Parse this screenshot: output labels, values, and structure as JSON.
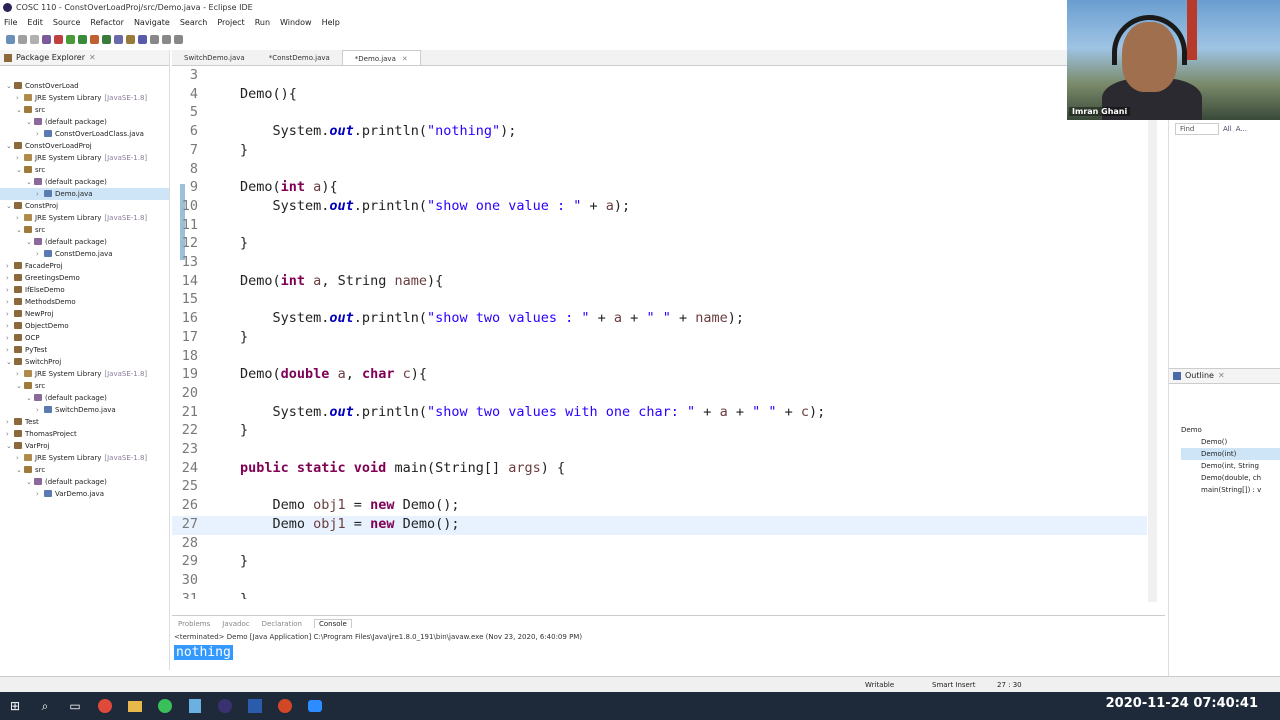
{
  "window": {
    "title": "COSC 110 - ConstOverLoadProj/src/Demo.java - Eclipse IDE"
  },
  "menu": [
    "File",
    "Edit",
    "Source",
    "Refactor",
    "Navigate",
    "Search",
    "Project",
    "Run",
    "Window",
    "Help"
  ],
  "package_explorer": {
    "title": "Package Explorer",
    "tree": [
      {
        "label": "ConstOverLoad",
        "level": 0,
        "arrow": "⌄",
        "kind": "project"
      },
      {
        "label": "JRE System Library",
        "suffix": "[JavaSE-1.8]",
        "level": 1,
        "arrow": "›",
        "kind": "lib"
      },
      {
        "label": "src",
        "level": 1,
        "arrow": "⌄",
        "kind": "src"
      },
      {
        "label": "(default package)",
        "level": 2,
        "arrow": "⌄",
        "kind": "pkg"
      },
      {
        "label": "ConstOverLoadClass.java",
        "level": 3,
        "arrow": "›",
        "kind": "file"
      },
      {
        "label": "ConstOverLoadProj",
        "level": 0,
        "arrow": "⌄",
        "kind": "project"
      },
      {
        "label": "JRE System Library",
        "suffix": "[JavaSE-1.8]",
        "level": 1,
        "arrow": "›",
        "kind": "lib"
      },
      {
        "label": "src",
        "level": 1,
        "arrow": "⌄",
        "kind": "src"
      },
      {
        "label": "(default package)",
        "level": 2,
        "arrow": "⌄",
        "kind": "pkg"
      },
      {
        "label": "Demo.java",
        "level": 3,
        "arrow": "›",
        "kind": "file",
        "selected": true
      },
      {
        "label": "ConstProj",
        "level": 0,
        "arrow": "⌄",
        "kind": "project"
      },
      {
        "label": "JRE System Library",
        "suffix": "[JavaSE-1.8]",
        "level": 1,
        "arrow": "›",
        "kind": "lib"
      },
      {
        "label": "src",
        "level": 1,
        "arrow": "⌄",
        "kind": "src"
      },
      {
        "label": "(default package)",
        "level": 2,
        "arrow": "⌄",
        "kind": "pkg"
      },
      {
        "label": "ConstDemo.java",
        "level": 3,
        "arrow": "›",
        "kind": "file"
      },
      {
        "label": "FacadeProj",
        "level": 0,
        "arrow": "›",
        "kind": "project"
      },
      {
        "label": "GreetingsDemo",
        "level": 0,
        "arrow": "›",
        "kind": "project"
      },
      {
        "label": "IfElseDemo",
        "level": 0,
        "arrow": "›",
        "kind": "project"
      },
      {
        "label": "MethodsDemo",
        "level": 0,
        "arrow": "›",
        "kind": "project"
      },
      {
        "label": "NewProj",
        "level": 0,
        "arrow": "›",
        "kind": "project"
      },
      {
        "label": "ObjectDemo",
        "level": 0,
        "arrow": "›",
        "kind": "project"
      },
      {
        "label": "OCP",
        "level": 0,
        "arrow": "›",
        "kind": "project"
      },
      {
        "label": "PyTest",
        "level": 0,
        "arrow": "›",
        "kind": "project"
      },
      {
        "label": "SwitchProj",
        "level": 0,
        "arrow": "⌄",
        "kind": "project"
      },
      {
        "label": "JRE System Library",
        "suffix": "[JavaSE-1.8]",
        "level": 1,
        "arrow": "›",
        "kind": "lib"
      },
      {
        "label": "src",
        "level": 1,
        "arrow": "⌄",
        "kind": "src"
      },
      {
        "label": "(default package)",
        "level": 2,
        "arrow": "⌄",
        "kind": "pkg"
      },
      {
        "label": "SwitchDemo.java",
        "level": 3,
        "arrow": "›",
        "kind": "file"
      },
      {
        "label": "Test",
        "level": 0,
        "arrow": "›",
        "kind": "project"
      },
      {
        "label": "ThomasProject",
        "level": 0,
        "arrow": "›",
        "kind": "project"
      },
      {
        "label": "VarProj",
        "level": 0,
        "arrow": "⌄",
        "kind": "project"
      },
      {
        "label": "JRE System Library",
        "suffix": "[JavaSE-1.8]",
        "level": 1,
        "arrow": "›",
        "kind": "lib"
      },
      {
        "label": "src",
        "level": 1,
        "arrow": "⌄",
        "kind": "src"
      },
      {
        "label": "(default package)",
        "level": 2,
        "arrow": "⌄",
        "kind": "pkg"
      },
      {
        "label": "VarDemo.java",
        "level": 3,
        "arrow": "›",
        "kind": "file"
      }
    ]
  },
  "editor_tabs": [
    {
      "label": "SwitchDemo.java",
      "active": false
    },
    {
      "label": "*ConstDemo.java",
      "active": false
    },
    {
      "label": "*Demo.java",
      "active": true
    }
  ],
  "code_lines": [
    {
      "n": "3",
      "tokens": []
    },
    {
      "n": "4",
      "tokens": [
        [
          "p",
          "Demo(){"
        ]
      ]
    },
    {
      "n": "5",
      "tokens": []
    },
    {
      "n": "6",
      "tokens": [
        [
          "p",
          "    System."
        ],
        [
          "f",
          "out"
        ],
        [
          "p",
          ".println("
        ],
        [
          "s",
          "\"nothing\""
        ],
        [
          "p",
          ");"
        ]
      ]
    },
    {
      "n": "7",
      "tokens": [
        [
          "p",
          "}"
        ]
      ]
    },
    {
      "n": "8",
      "tokens": []
    },
    {
      "n": "9",
      "tokens": [
        [
          "p",
          "Demo("
        ],
        [
          "k",
          "int"
        ],
        [
          "p",
          " "
        ],
        [
          "v",
          "a"
        ],
        [
          "p",
          "){"
        ]
      ]
    },
    {
      "n": "10",
      "tokens": [
        [
          "p",
          "    System."
        ],
        [
          "f",
          "out"
        ],
        [
          "p",
          ".println("
        ],
        [
          "s",
          "\"show one value : \""
        ],
        [
          "p",
          " + "
        ],
        [
          "v",
          "a"
        ],
        [
          "p",
          ");"
        ]
      ]
    },
    {
      "n": "11",
      "tokens": []
    },
    {
      "n": "12",
      "tokens": [
        [
          "p",
          "}"
        ]
      ]
    },
    {
      "n": "13",
      "tokens": []
    },
    {
      "n": "14",
      "tokens": [
        [
          "p",
          "Demo("
        ],
        [
          "k",
          "int"
        ],
        [
          "p",
          " "
        ],
        [
          "v",
          "a"
        ],
        [
          "p",
          ", String "
        ],
        [
          "v",
          "name"
        ],
        [
          "p",
          "){"
        ]
      ]
    },
    {
      "n": "15",
      "tokens": []
    },
    {
      "n": "16",
      "tokens": [
        [
          "p",
          "    System."
        ],
        [
          "f",
          "out"
        ],
        [
          "p",
          ".println("
        ],
        [
          "s",
          "\"show two values : \""
        ],
        [
          "p",
          " + "
        ],
        [
          "v",
          "a"
        ],
        [
          "p",
          " + "
        ],
        [
          "s",
          "\" \""
        ],
        [
          "p",
          " + "
        ],
        [
          "v",
          "name"
        ],
        [
          "p",
          ");"
        ]
      ]
    },
    {
      "n": "17",
      "tokens": [
        [
          "p",
          "}"
        ]
      ]
    },
    {
      "n": "18",
      "tokens": []
    },
    {
      "n": "19",
      "tokens": [
        [
          "p",
          "Demo("
        ],
        [
          "k",
          "double"
        ],
        [
          "p",
          " "
        ],
        [
          "v",
          "a"
        ],
        [
          "p",
          ", "
        ],
        [
          "k",
          "char"
        ],
        [
          "p",
          " "
        ],
        [
          "v",
          "c"
        ],
        [
          "p",
          "){"
        ]
      ]
    },
    {
      "n": "20",
      "tokens": []
    },
    {
      "n": "21",
      "tokens": [
        [
          "p",
          "    System."
        ],
        [
          "f",
          "out"
        ],
        [
          "p",
          ".println("
        ],
        [
          "s",
          "\"show two values with one char: \""
        ],
        [
          "p",
          " + "
        ],
        [
          "v",
          "a"
        ],
        [
          "p",
          " + "
        ],
        [
          "s",
          "\" \""
        ],
        [
          "p",
          " + "
        ],
        [
          "v",
          "c"
        ],
        [
          "p",
          ");"
        ]
      ]
    },
    {
      "n": "22",
      "tokens": [
        [
          "p",
          "}"
        ]
      ]
    },
    {
      "n": "23",
      "tokens": []
    },
    {
      "n": "24",
      "tokens": [
        [
          "k",
          "public static void"
        ],
        [
          "p",
          " main(String[] "
        ],
        [
          "v",
          "args"
        ],
        [
          "p",
          ") {"
        ]
      ]
    },
    {
      "n": "25",
      "tokens": []
    },
    {
      "n": "26",
      "tokens": [
        [
          "p",
          "    Demo "
        ],
        [
          "v",
          "obj1"
        ],
        [
          "p",
          " = "
        ],
        [
          "k",
          "new"
        ],
        [
          "p",
          " Demo();"
        ]
      ]
    },
    {
      "n": "27",
      "tokens": [
        [
          "p",
          "    Demo "
        ],
        [
          "v",
          "obj1"
        ],
        [
          "p",
          " = "
        ],
        [
          "k",
          "new"
        ],
        [
          "p",
          " Demo();"
        ]
      ],
      "current": true
    },
    {
      "n": "28",
      "tokens": []
    },
    {
      "n": "29",
      "tokens": [
        [
          "p",
          "}"
        ]
      ]
    },
    {
      "n": "30",
      "tokens": []
    },
    {
      "n": "31",
      "tokens": [
        [
          "p",
          "}"
        ]
      ]
    }
  ],
  "console": {
    "tabs": [
      "Problems",
      "Javadoc",
      "Declaration",
      "Console"
    ],
    "active": "Console",
    "info": "<terminated> Demo [Java Application] C:\\Program Files\\Java\\jre1.8.0_191\\bin\\javaw.exe (Nov 23, 2020, 6:40:09 PM)",
    "output": "nothing"
  },
  "find": {
    "placeholder": "Find",
    "all": "All",
    "more": "A..."
  },
  "outline": {
    "title": "Outline",
    "root": "Demo",
    "items": [
      "Demo()",
      "Demo(int)",
      "Demo(int, String",
      "Demo(double, ch",
      "main(String[]) : v"
    ]
  },
  "status": {
    "writable": "Writable",
    "insert": "Smart Insert",
    "position": "27 : 30"
  },
  "webcam": {
    "name": "Imran Ghani"
  },
  "taskbar": {
    "clock": "2020-11-24  07:40:41"
  },
  "colors": {
    "keyword": "#7f0055",
    "string": "#2a00ff",
    "field": "#0000c0",
    "selection": "#3399ff"
  }
}
